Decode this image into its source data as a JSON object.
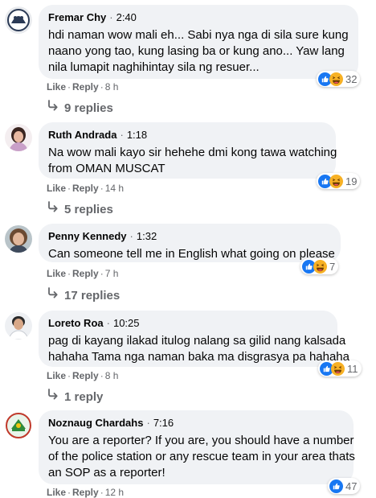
{
  "actions": {
    "like": "Like",
    "reply": "Reply",
    "dot": "·"
  },
  "comments": [
    {
      "author": "Fremar Chy",
      "time": "2:40",
      "lines": [
        "hdi naman wow mali eh... Sabi nya nga di sila sure kung",
        "naano yong tao, kung lasing ba or kung ano... Yaw lang",
        "nila lumapit naghihintay sila ng resuer..."
      ],
      "age": "8 h",
      "reactions": "32",
      "replies": "9 replies"
    },
    {
      "author": "Ruth Andrada",
      "time": "1:18",
      "lines": [
        "Na wow mali kayo sir hehehe dmi kong tawa watching",
        "from OMAN MUSCAT"
      ],
      "age": "14 h",
      "reactions": "19",
      "replies": "5 replies"
    },
    {
      "author": "Penny Kennedy",
      "time": "1:32",
      "lines": [
        "Can someone tell me in English what going on please"
      ],
      "age": "7 h",
      "reactions": "7",
      "replies": "17 replies"
    },
    {
      "author": "Loreto Roa",
      "time": "10:25",
      "lines": [
        "pag di kayang ilakad itulog nalang sa gilid nang kalsada",
        "hahaha Tama nga naman baka ma disgrasya pa hahaha"
      ],
      "age": "8 h",
      "reactions": "11",
      "replies": "1 reply"
    },
    {
      "author": "Noznaug Chardahs",
      "time": "7:16",
      "lines": [
        "You are a reporter? If you are, you should have a number",
        "of the police station or any rescue team in your area thats",
        "an SOP as a reporter!"
      ],
      "age": "12 h",
      "reactions": "47",
      "replies": ""
    }
  ],
  "colors": {
    "like_blue": "#1877f2",
    "haha_yellow": "#f7b125",
    "bubble": "#f0f2f5",
    "meta": "#65676b"
  }
}
